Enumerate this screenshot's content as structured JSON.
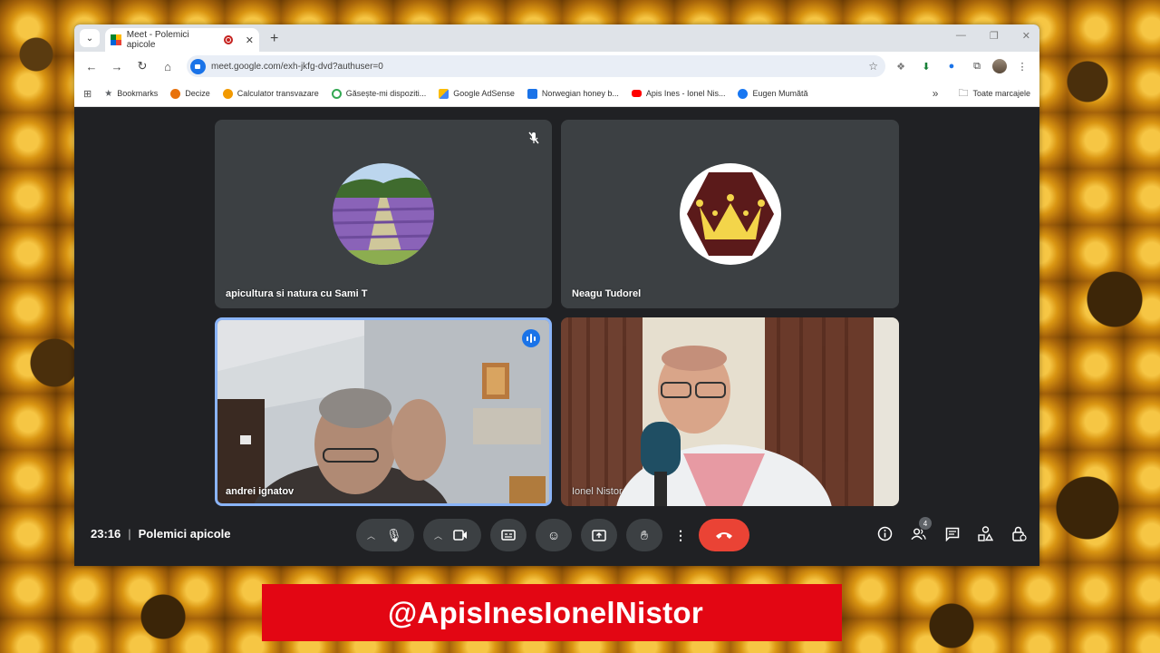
{
  "browser": {
    "tab_title": "Meet - Polemici apicole",
    "new_tab_label": "+",
    "window_controls": [
      "—",
      "❐",
      "✕"
    ],
    "url": "meet.google.com/exh-jkfg-dvd?authuser=0",
    "bookmarks": [
      {
        "label": "Bookmarks",
        "icon": "star-icon",
        "color": "#5f6368"
      },
      {
        "label": "Decize",
        "icon": "decize-icon",
        "color": "#e8710a"
      },
      {
        "label": "Calculator transvazare",
        "icon": "calculator-icon",
        "color": "#f29900"
      },
      {
        "label": "Găsește-mi dispoziti...",
        "icon": "find-device-icon",
        "color": "#34a853"
      },
      {
        "label": "Google AdSense",
        "icon": "adsense-icon",
        "color": "#fbbc04"
      },
      {
        "label": "Norwegian honey b...",
        "icon": "p-icon",
        "color": "#1a73e8"
      },
      {
        "label": "Apis Ines - Ionel Nis...",
        "icon": "youtube-icon",
        "color": "#ff0000"
      },
      {
        "label": "Eugen Mumătă",
        "icon": "facebook-icon",
        "color": "#1877f2"
      }
    ],
    "bookmarks_overflow": "»",
    "all_bookmarks_label": "Toate marcajele"
  },
  "meet": {
    "participants": [
      {
        "name": "apicultura si natura cu Sami T",
        "type": "avatar",
        "avatar": "lavender-field",
        "muted": true
      },
      {
        "name": "Neagu Tudorel",
        "type": "avatar",
        "avatar": "crown-hexagon",
        "muted": false
      },
      {
        "name": "andrei ignatov",
        "type": "video",
        "speaking": true
      },
      {
        "name": "Ionel Nistor",
        "type": "video",
        "speaking": false
      }
    ],
    "time": "23:16",
    "separator": "|",
    "meeting_name": "Polemici apicole",
    "people_count": "4",
    "colors": {
      "hangup": "#ea4335",
      "accent": "#1a73e8",
      "tile": "#3c4043",
      "background": "#202124"
    }
  },
  "banner": {
    "text": "@ApisInesIonelNistor",
    "color": "#e30613"
  }
}
